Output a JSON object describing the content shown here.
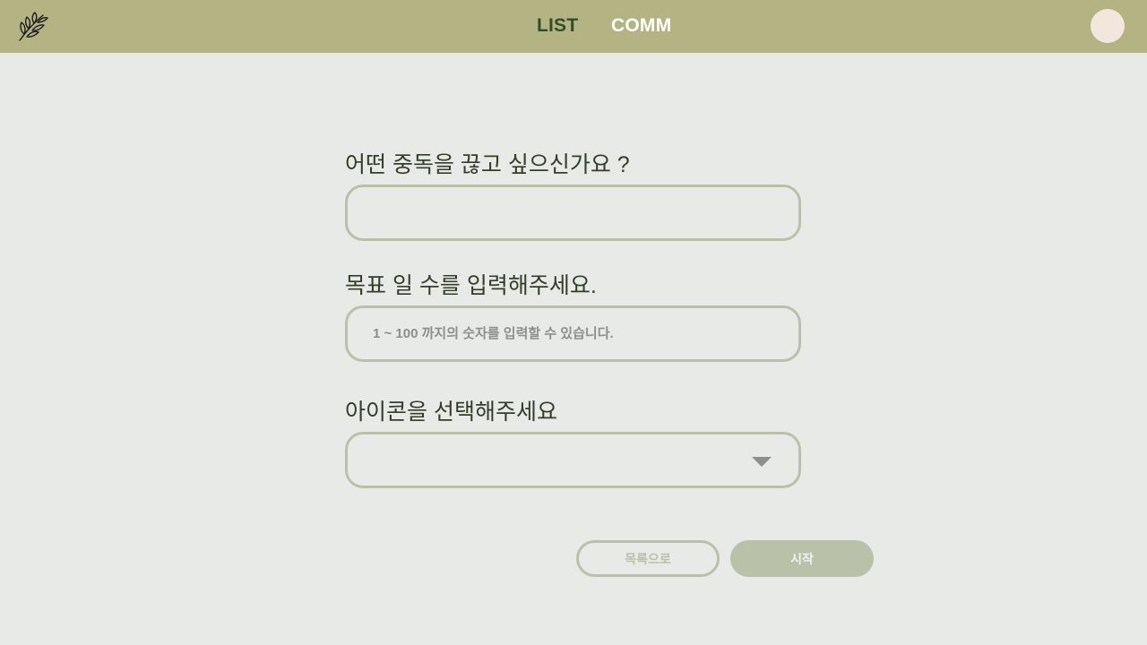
{
  "nav": {
    "list_label": "LIST",
    "comm_label": "COMM"
  },
  "form": {
    "addiction_label": "어떤 중독을 끊고 싶으신가요 ?",
    "addiction_value": "",
    "days_label": "목표 일 수를 입력해주세요.",
    "days_placeholder": "1 ~ 100 까지의 숫자를 입력할 수 있습니다.",
    "icon_label": "아이콘을 선택해주세요",
    "icon_selected": ""
  },
  "buttons": {
    "back_label": "목록으로",
    "start_label": "시작"
  },
  "icons": {
    "logo": "leaf-branch-icon",
    "dropdown": "triangle-down-icon"
  },
  "colors": {
    "topbar": "#b3b383",
    "accent": "#b9c2a9",
    "nav_active": "#334d26",
    "avatar": "#f3e7dd"
  }
}
